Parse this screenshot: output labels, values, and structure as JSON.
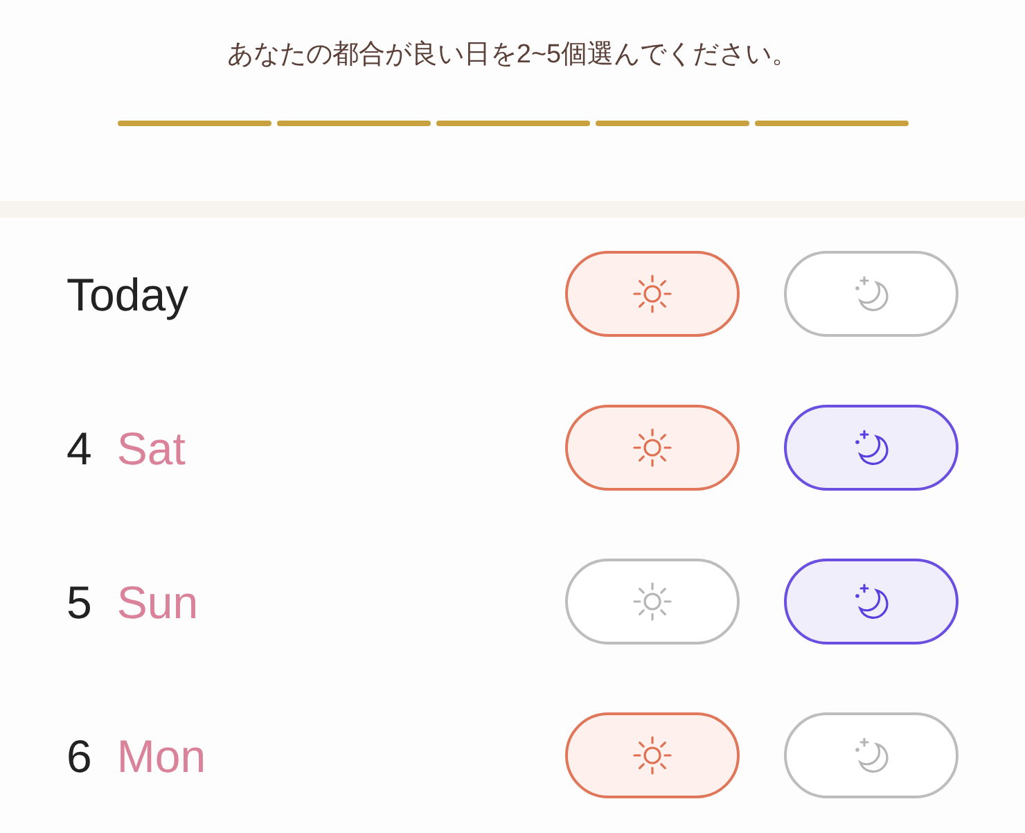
{
  "instruction": "あなたの都合が良い日を2~5個選んでください。",
  "progress": [
    {
      "filled": true
    },
    {
      "filled": true
    },
    {
      "filled": true
    },
    {
      "filled": true
    },
    {
      "filled": true
    }
  ],
  "days": [
    {
      "label": "Today",
      "day_selected": true,
      "night_selected": false
    },
    {
      "number": "4",
      "weekday": "Sat",
      "day_selected": true,
      "night_selected": true
    },
    {
      "number": "5",
      "weekday": "Sun",
      "day_selected": false,
      "night_selected": true
    },
    {
      "number": "6",
      "weekday": "Mon",
      "day_selected": true,
      "night_selected": false
    }
  ]
}
